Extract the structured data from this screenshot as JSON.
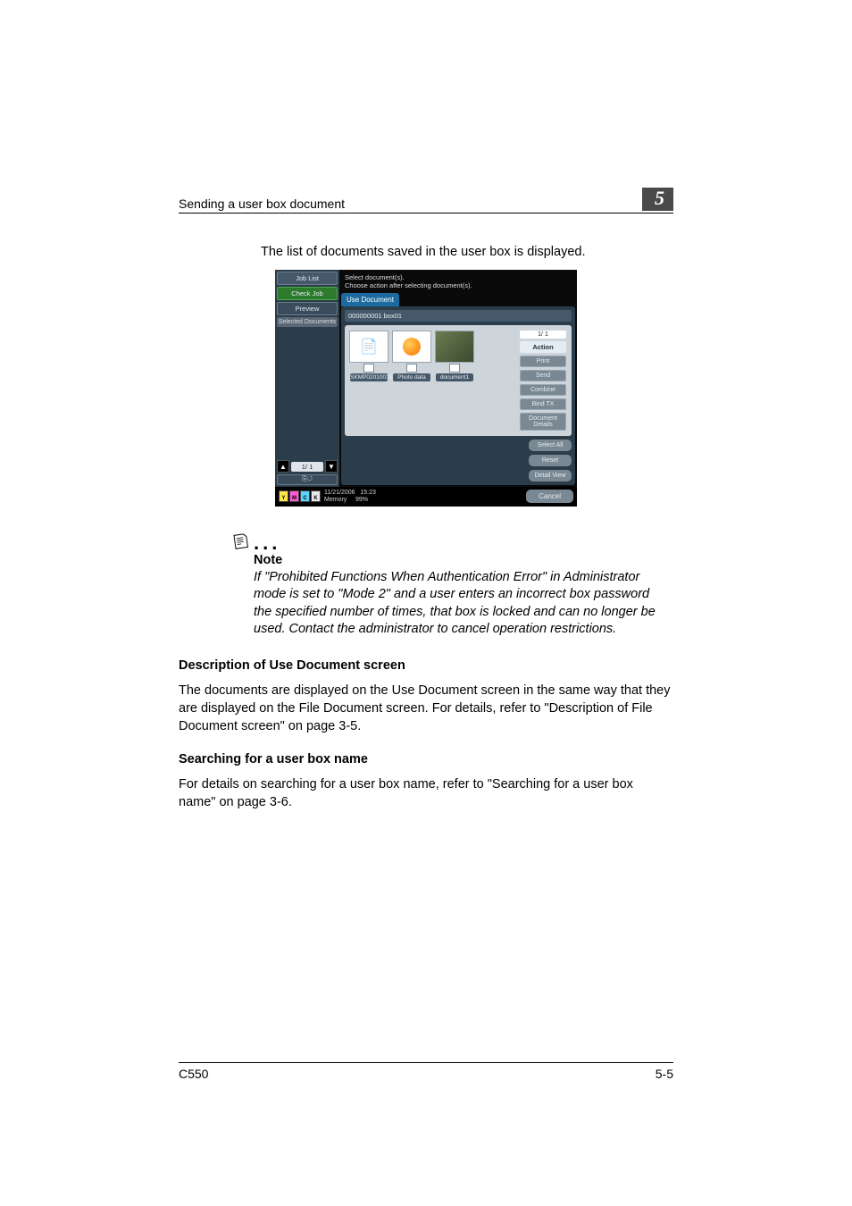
{
  "header": {
    "running_head": "Sending a user box document",
    "chapter_number": "5"
  },
  "intro": "The list of documents saved in the user box is displayed.",
  "screen": {
    "left": {
      "job_list": "Job List",
      "check_job": "Check Job",
      "preview": "Preview",
      "selected_documents": "Selected Documents",
      "pager": "1/  1",
      "mini": "⎘↺"
    },
    "message_line1": "Select document(s).",
    "message_line2": "Choose action after selecting document(s).",
    "tab": "Use Document",
    "box_id": "000000001   box01",
    "thumbs": [
      {
        "label": "SKMP02010010"
      },
      {
        "label": "Photo data"
      },
      {
        "label": "document1"
      }
    ],
    "right_page": "1/  1",
    "action_head": "Action",
    "actions": [
      "Print",
      "Send",
      "Combine",
      "Bind TX",
      "Document Details"
    ],
    "below": {
      "select": "Select All",
      "reset": "Reset",
      "detail": "Detail View"
    },
    "footer": {
      "date": "11/21/2006",
      "time": "15:23",
      "memory": "Memory",
      "pct": "99%",
      "cancel": "Cancel"
    }
  },
  "note": {
    "label": "Note",
    "text": "If \"Prohibited Functions When Authentication Error\" in Administrator mode is set to \"Mode 2\" and a user enters an incorrect box password the specified number of times, that box is locked and can no longer be used. Contact the administrator to cancel operation restrictions."
  },
  "section1": {
    "head": "Description of Use Document screen",
    "body": "The documents are displayed on the Use Document screen in the same way that they are displayed on the File Document screen. For details, refer to \"Description of File Document screen\" on page 3-5."
  },
  "section2": {
    "head": "Searching for a user box name",
    "body": "For details on searching for a user box name, refer to \"Searching for a user box name\" on page 3-6."
  },
  "footer": {
    "model": "C550",
    "page": "5-5"
  }
}
